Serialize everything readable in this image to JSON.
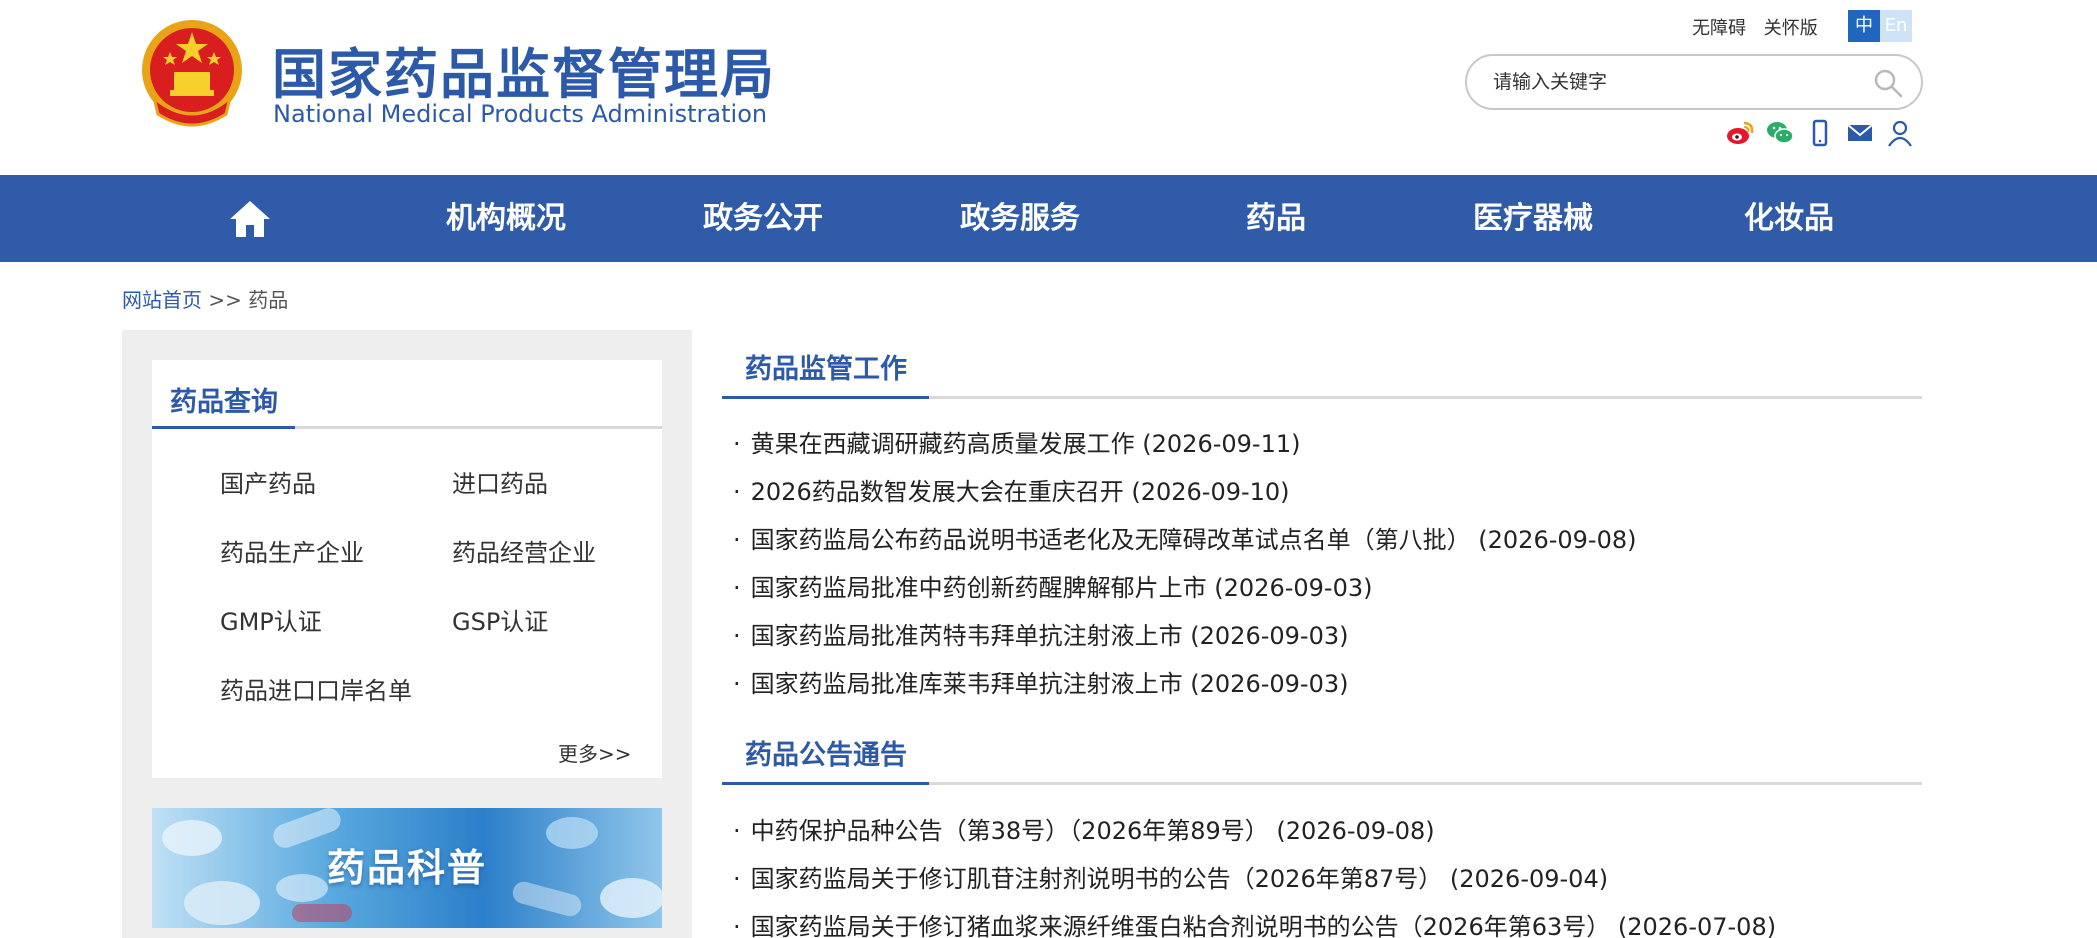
{
  "header": {
    "title_cn": "国家药品监督管理局",
    "title_en": "National Medical Products Administration",
    "accessibility_link": "无障碍",
    "elderly_link": "关怀版",
    "lang_zh": "中",
    "lang_en": "En"
  },
  "search": {
    "placeholder": "请输入关键字"
  },
  "social_icons": [
    "weibo-icon",
    "wechat-icon",
    "mobile-icon",
    "mail-icon",
    "user-icon"
  ],
  "nav": {
    "items": [
      "机构概况",
      "政务公开",
      "政务服务",
      "药品",
      "医疗器械",
      "化妆品"
    ]
  },
  "breadcrumb": {
    "home": "网站首页",
    "separator": ">>",
    "current": "药品"
  },
  "sidebar": {
    "query_title": "药品查询",
    "items": [
      "国产药品",
      "进口药品",
      "药品生产企业",
      "药品经营企业",
      "GMP认证",
      "GSP认证",
      "药品进口口岸名单"
    ],
    "more": "更多>>",
    "banner_text": "药品科普"
  },
  "sections": [
    {
      "title": "药品监管工作",
      "items": [
        "黄果在西藏调研藏药高质量发展工作 (2026-09-11)",
        "2026药品数智发展大会在重庆召开 (2026-09-10)",
        "国家药监局公布药品说明书适老化及无障碍改革试点名单（第八批） (2026-09-08)",
        "国家药监局批准中药创新药醒脾解郁片上市 (2026-09-03)",
        "国家药监局批准芮特韦拜单抗注射液上市 (2026-09-03)",
        "国家药监局批准库莱韦拜单抗注射液上市 (2026-09-03)"
      ]
    },
    {
      "title": "药品公告通告",
      "items": [
        "中药保护品种公告（第38号）（2026年第89号） (2026-09-08)",
        "国家药监局关于修订肌苷注射剂说明书的公告（2026年第87号） (2026-09-04)",
        "国家药监局关于修订猪血浆来源纤维蛋白粘合剂说明书的公告（2026年第63号） (2026-07-08)"
      ]
    }
  ],
  "colors": {
    "brand_blue": "#2f5ba9",
    "title_blue": "#2d5aa8",
    "divider_gray": "#d9d9d9",
    "sidebar_bg": "#eeeeee"
  }
}
